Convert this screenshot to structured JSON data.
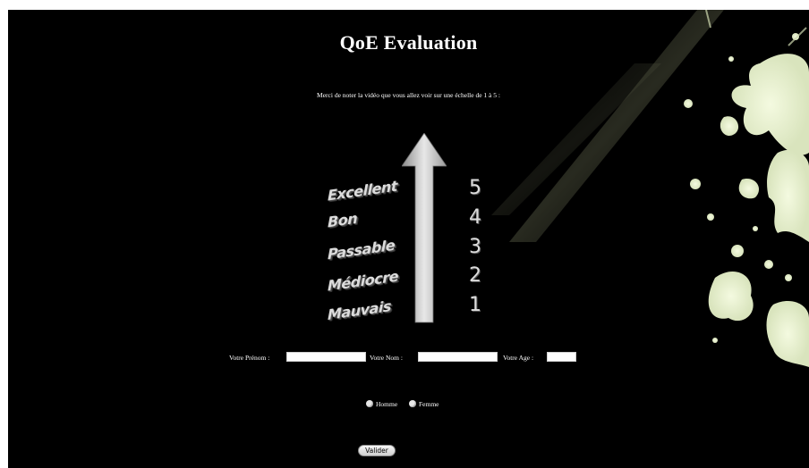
{
  "page": {
    "title": "QoE Evaluation",
    "instruction": "Merci de noter la vidéo que vous allez voir sur une échelle de 1 à 5 :"
  },
  "scale": {
    "levels": [
      {
        "label": "Excellent",
        "value": "5"
      },
      {
        "label": "Bon",
        "value": "4"
      },
      {
        "label": "Passable",
        "value": "3"
      },
      {
        "label": "Médiocre",
        "value": "2"
      },
      {
        "label": "Mauvais",
        "value": "1"
      }
    ]
  },
  "form": {
    "first_name_label": "Votre Prénom :",
    "first_name_value": "",
    "last_name_label": "Votre Nom :",
    "last_name_value": "",
    "age_label": "Votre Age :",
    "age_value": "",
    "gender_options": [
      "Homme",
      "Femme"
    ],
    "submit_label": "Valider"
  },
  "colors": {
    "background": "#000000",
    "text": "#ffffff",
    "scale_text": "#dcdcdc"
  }
}
